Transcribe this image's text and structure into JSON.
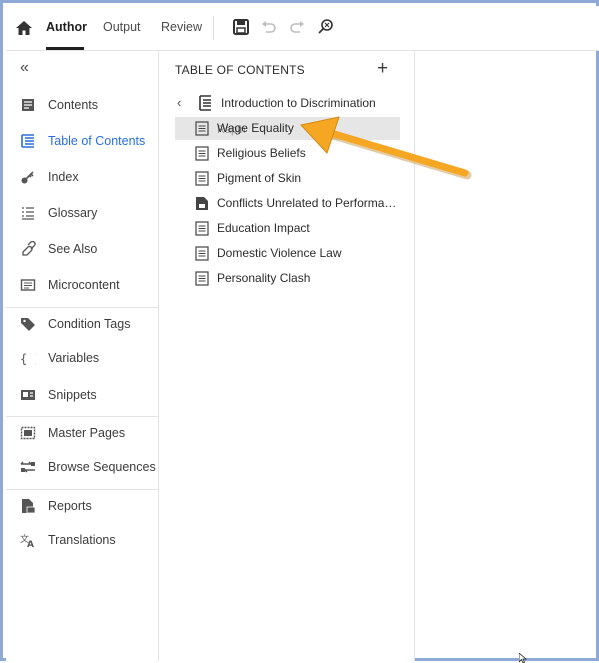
{
  "toolbar": {
    "tabs": [
      {
        "label": "Author",
        "active": true
      },
      {
        "label": "Output",
        "active": false
      },
      {
        "label": "Review",
        "active": false
      }
    ],
    "icons": [
      "home-icon",
      "save-icon",
      "undo-icon",
      "redo-icon",
      "find-replace-icon"
    ]
  },
  "leftnav": {
    "collapse_glyph": "«",
    "items": [
      {
        "label": "Contents",
        "icon": "contents-icon",
        "active": false
      },
      {
        "label": "Table of Contents",
        "icon": "toc-icon",
        "active": true
      },
      {
        "label": "Index",
        "icon": "key-icon",
        "active": false
      },
      {
        "label": "Glossary",
        "icon": "glossary-icon",
        "active": false
      },
      {
        "label": "See Also",
        "icon": "see-also-icon",
        "active": false
      },
      {
        "label": "Microcontent",
        "icon": "microcontent-icon",
        "active": false
      },
      {
        "label": "Condition Tags",
        "icon": "tag-icon",
        "active": false
      },
      {
        "label": "Variables",
        "icon": "braces-icon",
        "active": false
      },
      {
        "label": "Snippets",
        "icon": "snippet-icon",
        "active": false
      },
      {
        "label": "Master Pages",
        "icon": "master-page-icon",
        "active": false
      },
      {
        "label": "Browse Sequences",
        "icon": "browse-sequence-icon",
        "active": false
      },
      {
        "label": "Reports",
        "icon": "report-icon",
        "active": false
      },
      {
        "label": "Translations",
        "icon": "translate-icon",
        "active": false
      }
    ]
  },
  "toc": {
    "title": "TABLE OF CONTENTS",
    "add_glyph": "+",
    "root": {
      "label": "Introduction to Discrimination"
    },
    "items": [
      {
        "label": "Wage Equality",
        "selected": true,
        "icon": "topic-icon"
      },
      {
        "label": "Religious Beliefs",
        "selected": false,
        "icon": "topic-icon"
      },
      {
        "label": "Pigment of Skin",
        "selected": false,
        "icon": "topic-icon"
      },
      {
        "label": "Conflicts Unrelated to Performanc...",
        "selected": false,
        "icon": "html-topic-icon"
      },
      {
        "label": "Education Impact",
        "selected": false,
        "icon": "topic-icon"
      },
      {
        "label": "Domestic Violence Law",
        "selected": false,
        "icon": "topic-icon"
      },
      {
        "label": "Personality Clash",
        "selected": false,
        "icon": "topic-icon"
      }
    ],
    "drag_ghost": "Rapin",
    "colors": {
      "selected_bg": "#e6e6e6",
      "arrow": "#f5a623",
      "active_nav": "#2a6fdb"
    }
  }
}
